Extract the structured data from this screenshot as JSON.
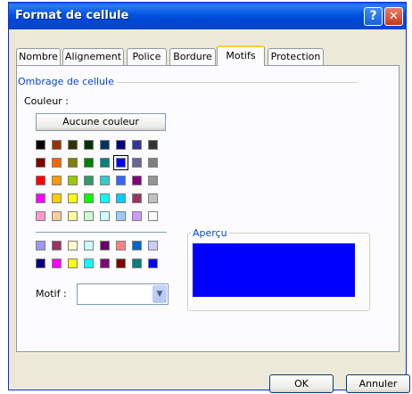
{
  "window": {
    "title": "Format de cellule",
    "help_glyph": "?",
    "close_glyph": "✕"
  },
  "tabs": [
    {
      "label": "Nombre",
      "active": false
    },
    {
      "label": "Alignement",
      "active": false
    },
    {
      "label": "Police",
      "active": false
    },
    {
      "label": "Bordure",
      "active": false
    },
    {
      "label": "Motifs",
      "active": true
    },
    {
      "label": "Protection",
      "active": false
    }
  ],
  "shading": {
    "group_title": "Ombrage de cellule",
    "color_label": "Couleur :",
    "no_color_button": "Aucune couleur",
    "selected_color": "#0000ff",
    "palette_main": [
      [
        "#000000",
        "#993300",
        "#333300",
        "#003300",
        "#003366",
        "#000080",
        "#333399",
        "#333333"
      ],
      [
        "#800000",
        "#ff6600",
        "#808000",
        "#008000",
        "#008080",
        "#0000ff",
        "#666699",
        "#808080"
      ],
      [
        "#ff0000",
        "#ff9900",
        "#99cc00",
        "#339966",
        "#33cccc",
        "#3366ff",
        "#800080",
        "#969696"
      ],
      [
        "#ff00ff",
        "#ffcc00",
        "#ffff00",
        "#00ff00",
        "#00ffff",
        "#00ccff",
        "#993366",
        "#c0c0c0"
      ],
      [
        "#ff99cc",
        "#ffcc99",
        "#ffff99",
        "#ccffcc",
        "#ccffff",
        "#99ccff",
        "#cc99ff",
        "#ffffff"
      ]
    ],
    "palette_chart": [
      [
        "#9999ff",
        "#993366",
        "#ffffcc",
        "#ccffff",
        "#660066",
        "#ff8080",
        "#0066cc",
        "#ccccff"
      ],
      [
        "#000080",
        "#ff00ff",
        "#ffff00",
        "#00ffff",
        "#800080",
        "#800000",
        "#008080",
        "#0000ff"
      ]
    ],
    "pattern_label": "Motif :",
    "pattern_value": "",
    "dropdown_glyph": "▼"
  },
  "preview": {
    "title": "Aperçu",
    "color": "#0000ff"
  },
  "buttons": {
    "ok": "OK",
    "cancel": "Annuler"
  }
}
